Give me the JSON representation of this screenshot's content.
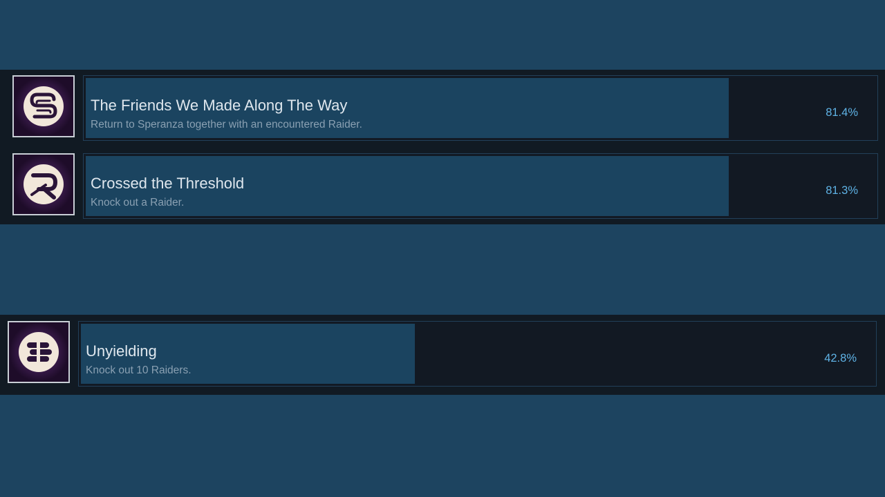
{
  "achievements": [
    {
      "title": "The Friends We Made Along The Way",
      "description": "Return to Speranza together with an encountered Raider.",
      "percent_label": "81.4%",
      "percent": 81.4,
      "icon": "speranza-s-emblem-icon"
    },
    {
      "title": "Crossed the Threshold",
      "description": "Knock out a Raider.",
      "percent_label": "81.3%",
      "percent": 81.3,
      "icon": "raider-r-emblem-icon"
    },
    {
      "title": "Unyielding",
      "description": "Knock out 10 Raiders.",
      "percent_label": "42.8%",
      "percent": 42.8,
      "icon": "raider-stack-emblem-icon"
    }
  ],
  "colors": {
    "page_background": "#1d4460",
    "band_background": "#111a23",
    "progress_fill": "#1b4460",
    "percent_text": "#5fb3e6",
    "icon_background": "#2a1438",
    "icon_glyph": "#f1e7da"
  }
}
